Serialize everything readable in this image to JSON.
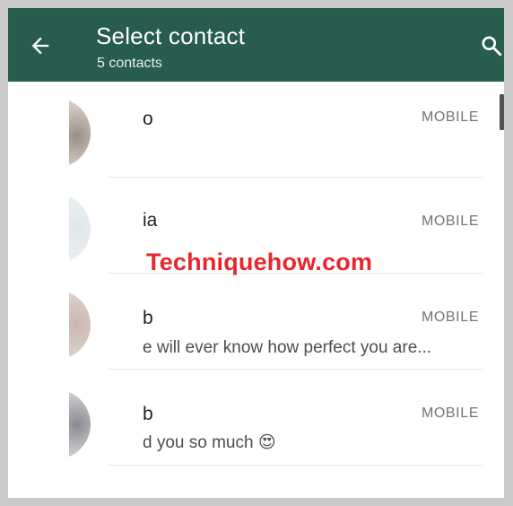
{
  "header": {
    "title": "Select contact",
    "subtitle": "5 contacts",
    "background_color": "#275c4f"
  },
  "icons": {
    "back": "arrow-left-icon",
    "search": "search-icon"
  },
  "contacts": [
    {
      "name": "o",
      "type": "MOBILE",
      "status": ""
    },
    {
      "name": "ia",
      "type": "MOBILE",
      "status": ""
    },
    {
      "name": "b",
      "type": "MOBILE",
      "status": "e will ever know how perfect you are..."
    },
    {
      "name": "b",
      "type": "MOBILE",
      "status": "d you so much 😍"
    }
  ],
  "watermark": {
    "text": "Techniquehow.com",
    "color": "#e8262b"
  }
}
